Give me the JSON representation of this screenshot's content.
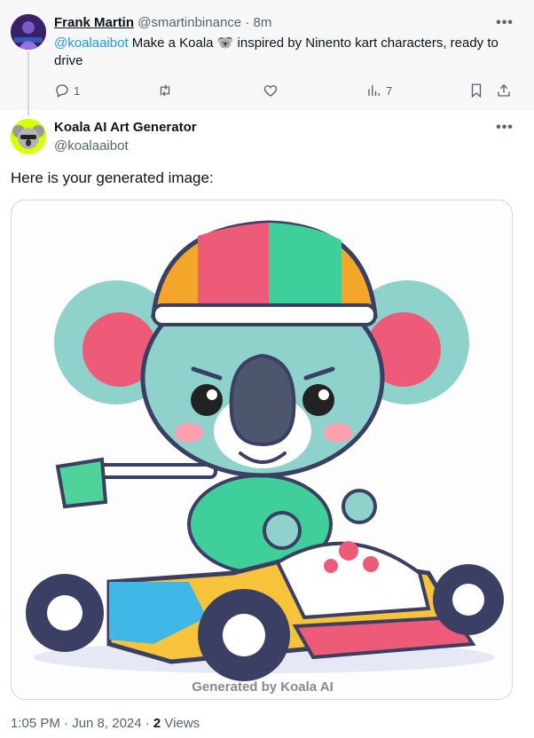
{
  "parent_tweet": {
    "author_name": "Frank Martin",
    "author_handle": "@smartinbinance",
    "time_ago": "· 8m",
    "mention": "@koalaaibot",
    "text_before_emoji": " Make a Koala ",
    "emoji": "🐨",
    "text_after_emoji": " inspired by Ninento kart characters, ready to drive",
    "replies": "1",
    "views": "7",
    "more_glyph": "•••"
  },
  "reply_tweet": {
    "author_name": "Koala AI Art Generator",
    "author_handle": "@koalaaibot",
    "more_glyph": "•••",
    "text": "Here is your generated image:",
    "image_watermark": "Generated by Koala AI"
  },
  "meta": {
    "timestamp": "1:05 PM · Jun 8, 2024 · ",
    "views_count": "2",
    "views_label": " Views"
  },
  "icons": {
    "reply": "reply-icon",
    "retweet": "retweet-icon",
    "like": "like-icon",
    "views": "views-icon",
    "bookmark": "bookmark-icon",
    "share": "share-icon"
  },
  "colors": {
    "link": "#1d9bf0",
    "muted": "#536471",
    "parent_bg": "#f7f7f7"
  }
}
